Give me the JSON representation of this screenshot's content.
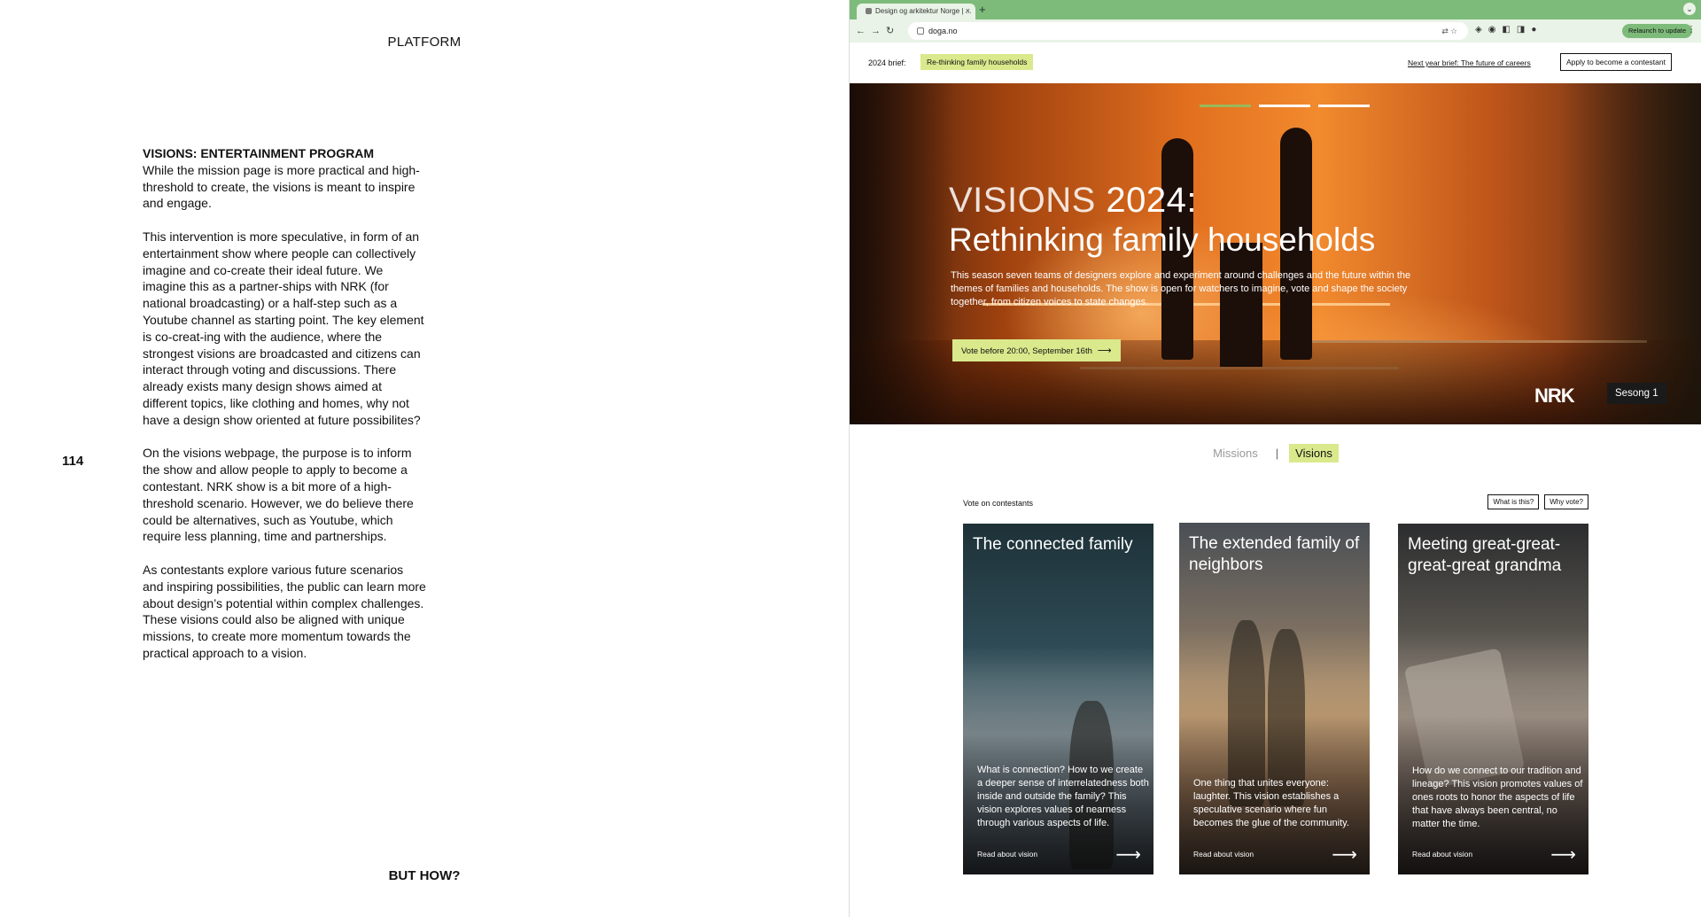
{
  "left_page": {
    "header": "PLATFORM",
    "page_number": "114",
    "footer": "BUT HOW?",
    "heading": "VISIONS: ENTERTAINMENT PROGRAM",
    "paragraphs": [
      "While the mission page is more practical and high-threshold to create, the visions is meant to inspire and engage.",
      "This intervention is more speculative, in form of an entertainment show where people can collectively imagine and co-create their ideal future. We imagine this as a partner-ships with NRK (for national broadcasting) or a half-step such as a Youtube channel as starting point. The key element is co-creat-ing with the audience, where the strongest visions are broadcasted and citizens can interact through voting and discussions. There already exists many design shows aimed at different topics, like clothing and homes, why not have a design show oriented at future possibilites?",
      "On the visions webpage, the purpose is to inform the show and allow people to apply to become a contestant. NRK show is a bit more of a high-threshold scenario. However, we do believe there could be alternatives, such as Youtube, which require less planning, time and partnerships.",
      "As contestants explore various future scenarios and inspiring possibilities, the public can learn more about design’s potential within complex challenges. These visions could also be aligned with unique missions, to create more momentum towards the practical approach to a vision."
    ]
  },
  "browser": {
    "tab_title": "Design og arkitektur Norge | ...",
    "url": "doga.no",
    "relaunch_label": "Relaunch to update",
    "accent_color": "#7dbb7a"
  },
  "site": {
    "brief_label": "2024 brief:",
    "brief_tag": "Re-thinking family households",
    "next_brief": "Next year brief: The future of careers",
    "apply_button": "Apply to become a contestant",
    "hero": {
      "title_light": "VISIONS",
      "title_year": "2024:",
      "title_main": "Rethinking family households",
      "description": "This season seven teams of designers explore and experiment around challenges and the future within the themes of families and households. The show is open for watchers to imagine, vote and shape the society together, from citizen voices to state changes.",
      "vote_button": "Vote before 20:00, September 16th",
      "broadcaster": "NRK",
      "season": "Sesong 1"
    },
    "tabs": {
      "missions": "Missions",
      "separator": "|",
      "visions": "Visions"
    },
    "vote_label": "Vote on contestants",
    "what_is_this": "What is this?",
    "why_vote": "Why vote?",
    "accent_color": "#d9e98c",
    "cards": [
      {
        "title": "The connected family",
        "description": "What is connection? How to we create a deeper sense of interrelatedness both inside and outside the family? This vision explores values of nearness through various aspects of life.",
        "link": "Read about vision"
      },
      {
        "title": "The extended family of neighbors",
        "description": "One thing that unites everyone: laughter. This vision establishes a speculative scenario where fun becomes the glue of the community.",
        "link": "Read about vision"
      },
      {
        "title": "Meeting great-great-great-great grandma",
        "description": "How do we connect to our tradition and lineage? This vision promotes values of ones roots to honor the aspects of life that have always been central, no matter the time.",
        "link": "Read about vision"
      }
    ]
  }
}
